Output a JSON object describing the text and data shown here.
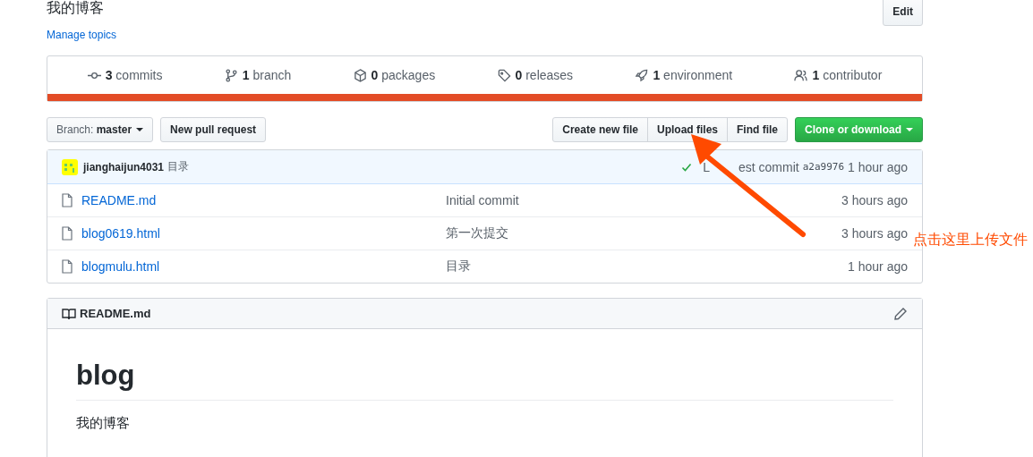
{
  "repo": {
    "description": "我的博客",
    "edit_button": "Edit",
    "topics_link": "Manage topics"
  },
  "stats": [
    {
      "kind": "commit",
      "count": "3",
      "label": "commits"
    },
    {
      "kind": "branch",
      "count": "1",
      "label": "branch"
    },
    {
      "kind": "package",
      "count": "0",
      "label": "packages"
    },
    {
      "kind": "tag",
      "count": "0",
      "label": "releases"
    },
    {
      "kind": "rocket",
      "count": "1",
      "label": "environment"
    },
    {
      "kind": "people",
      "count": "1",
      "label": "contributor"
    }
  ],
  "toolbar": {
    "branch_label": "Branch:",
    "branch": "master",
    "pull_request": "New pull request",
    "file_buttons": [
      "Create new file",
      "Upload files",
      "Find file"
    ],
    "clone": "Clone or download"
  },
  "commit_bar": {
    "author": "jianghaijun4031",
    "message": "目录",
    "latest": [
      "L",
      "est commit"
    ],
    "hash": "a2a9976",
    "time": "1 hour ago"
  },
  "files": [
    {
      "name": "README.md",
      "message": "Initial commit",
      "time": "3 hours ago"
    },
    {
      "name": "blog0619.html",
      "message": "第一次提交",
      "time": "3 hours ago"
    },
    {
      "name": "blogmulu.html",
      "message": "目录",
      "time": "1 hour ago"
    }
  ],
  "readme": {
    "filename": "README.md",
    "heading": "blog",
    "body": "我的博客"
  },
  "annotation": {
    "text": "点击这里上传文件"
  }
}
